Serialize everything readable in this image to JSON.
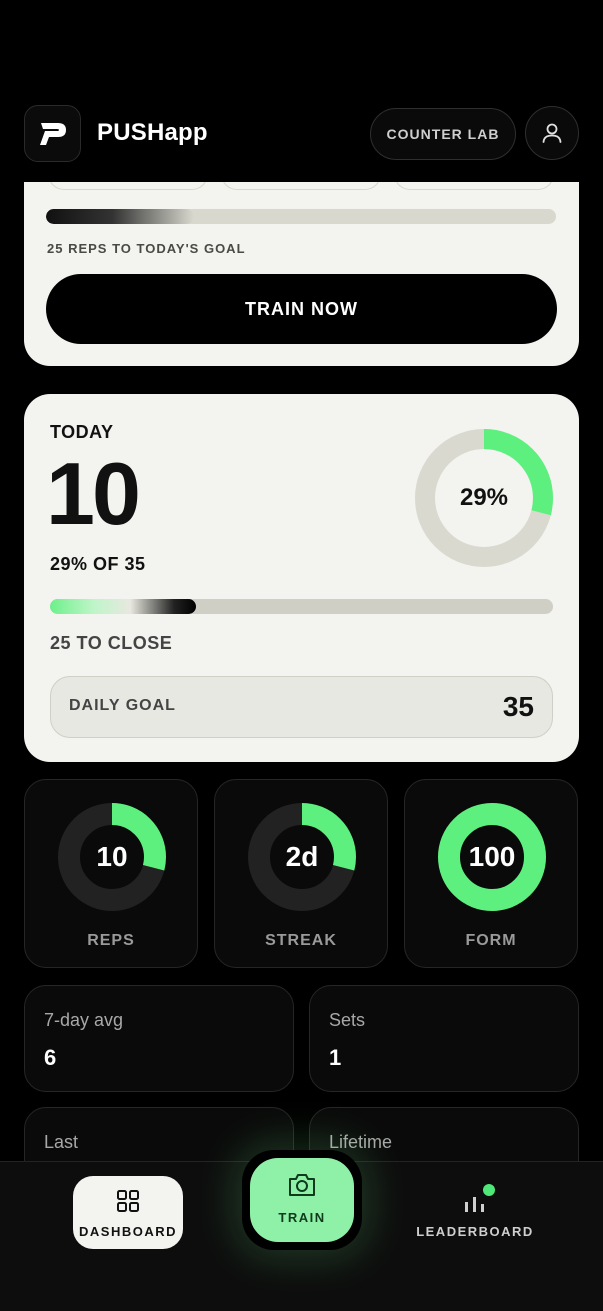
{
  "header": {
    "app_title": "PUSHapp",
    "counter_lab_label": "COUNTER LAB"
  },
  "top_card": {
    "progress_fraction": 0.29,
    "reps_to_goal_text": "25 REPS TO TODAY'S GOAL",
    "train_now_label": "TRAIN NOW"
  },
  "today": {
    "label": "TODAY",
    "count": "10",
    "percent_of_goal": "29% OF 35",
    "ring_percent_text": "29%",
    "ring_fraction": 0.29,
    "to_close_text": "25 TO CLOSE",
    "daily_goal_label": "DAILY GOAL",
    "daily_goal_value": "35"
  },
  "tiles": [
    {
      "value": "10",
      "label": "REPS",
      "fraction": 0.29
    },
    {
      "value": "2d",
      "label": "STREAK",
      "fraction": 0.29
    },
    {
      "value": "100",
      "label": "FORM",
      "fraction": 1.0
    }
  ],
  "stats": [
    {
      "label": "7-day avg",
      "value": "6"
    },
    {
      "label": "Sets",
      "value": "1"
    },
    {
      "label": "Last",
      "value": ""
    },
    {
      "label": "Lifetime",
      "value": ""
    }
  ],
  "nav": {
    "dashboard_label": "DASHBOARD",
    "train_label": "TRAIN",
    "leaderboard_label": "LEADERBOARD"
  },
  "colors": {
    "accent_green": "#5ef07e",
    "card_bg": "#f3f3ef",
    "train_button": "#8ff0a8"
  },
  "icons": [
    "logo-p-icon",
    "user-icon",
    "grid-icon",
    "camera-icon",
    "bar-chart-icon"
  ]
}
